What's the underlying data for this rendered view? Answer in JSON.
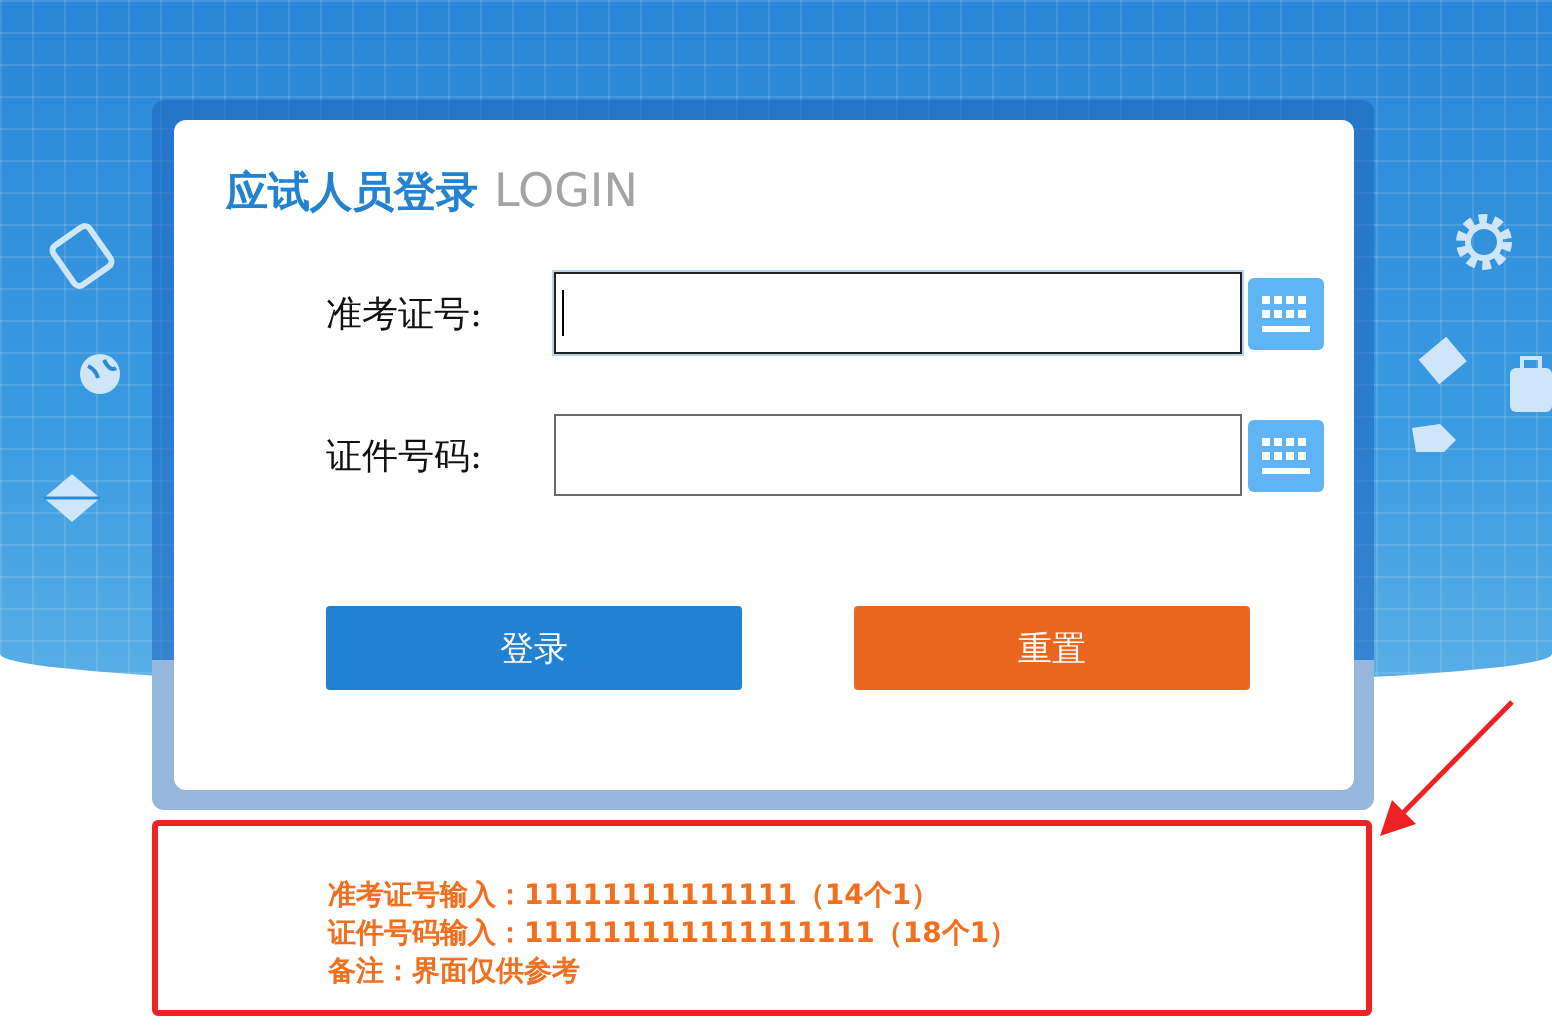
{
  "login": {
    "title": "应试人员登录",
    "title_en": "LOGIN",
    "fields": [
      {
        "label": "准考证号:",
        "focused": true
      },
      {
        "label": "证件号码:",
        "focused": false
      }
    ],
    "buttons": [
      {
        "label": "登录",
        "kind": "primary"
      },
      {
        "label": "重置",
        "kind": "reset"
      }
    ]
  },
  "note": {
    "lines": [
      "准考证号输入：11111111111111（14个1）",
      "证件号码输入：111111111111111111（18个1）",
      "备注：界面仅供参考"
    ]
  }
}
